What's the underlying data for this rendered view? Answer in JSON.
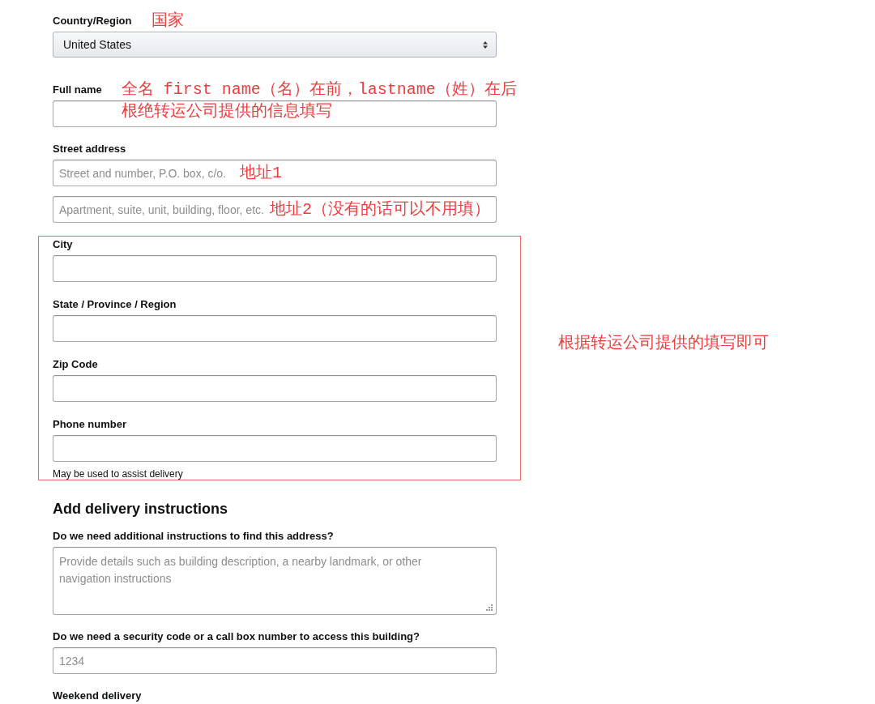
{
  "sections": [
    {
      "kind": "plain",
      "fields": [
        {
          "label": "Country/Region",
          "annotation": [
            "国家"
          ],
          "inputs": [
            {
              "kind": "select",
              "value": "United States"
            }
          ]
        },
        {
          "label": "Full name",
          "annotation": [
            "全名 first name（名）在前，lastname（姓）在后",
            "根绝转运公司提供的信息填写"
          ],
          "inputs": [
            {
              "kind": "text"
            }
          ]
        },
        {
          "label": "Street address",
          "inputs": [
            {
              "kind": "text",
              "placeholder": "Street and number, P.O. box, c/o.",
              "annotation": "地址1"
            },
            {
              "kind": "text",
              "placeholder": "Apartment, suite, unit, building, floor, etc.",
              "annotation": "地址2（没有的话可以不用填）"
            }
          ]
        }
      ]
    },
    {
      "kind": "highlighted",
      "annotation": "根据转运公司提供的填写即可",
      "fields": [
        {
          "label": "City",
          "inputs": [
            {
              "kind": "text"
            }
          ]
        },
        {
          "label": "State / Province / Region",
          "inputs": [
            {
              "kind": "text"
            }
          ]
        },
        {
          "label": "Zip Code",
          "inputs": [
            {
              "kind": "text"
            }
          ]
        },
        {
          "label": "Phone number",
          "inputs": [
            {
              "kind": "text"
            }
          ],
          "hint": "May be used to assist delivery"
        }
      ]
    },
    {
      "kind": "plain",
      "heading": "Add delivery instructions",
      "fields": [
        {
          "label": "Do we need additional instructions to find this address?",
          "inputs": [
            {
              "kind": "textarea",
              "placeholder": "Provide details such as building description, a nearby landmark, or other navigation instructions"
            }
          ]
        },
        {
          "label": "Do we need a security code or a call box number to access this building?",
          "inputs": [
            {
              "kind": "text",
              "placeholder": "1234"
            }
          ]
        },
        {
          "label": "Weekend delivery"
        }
      ]
    }
  ]
}
